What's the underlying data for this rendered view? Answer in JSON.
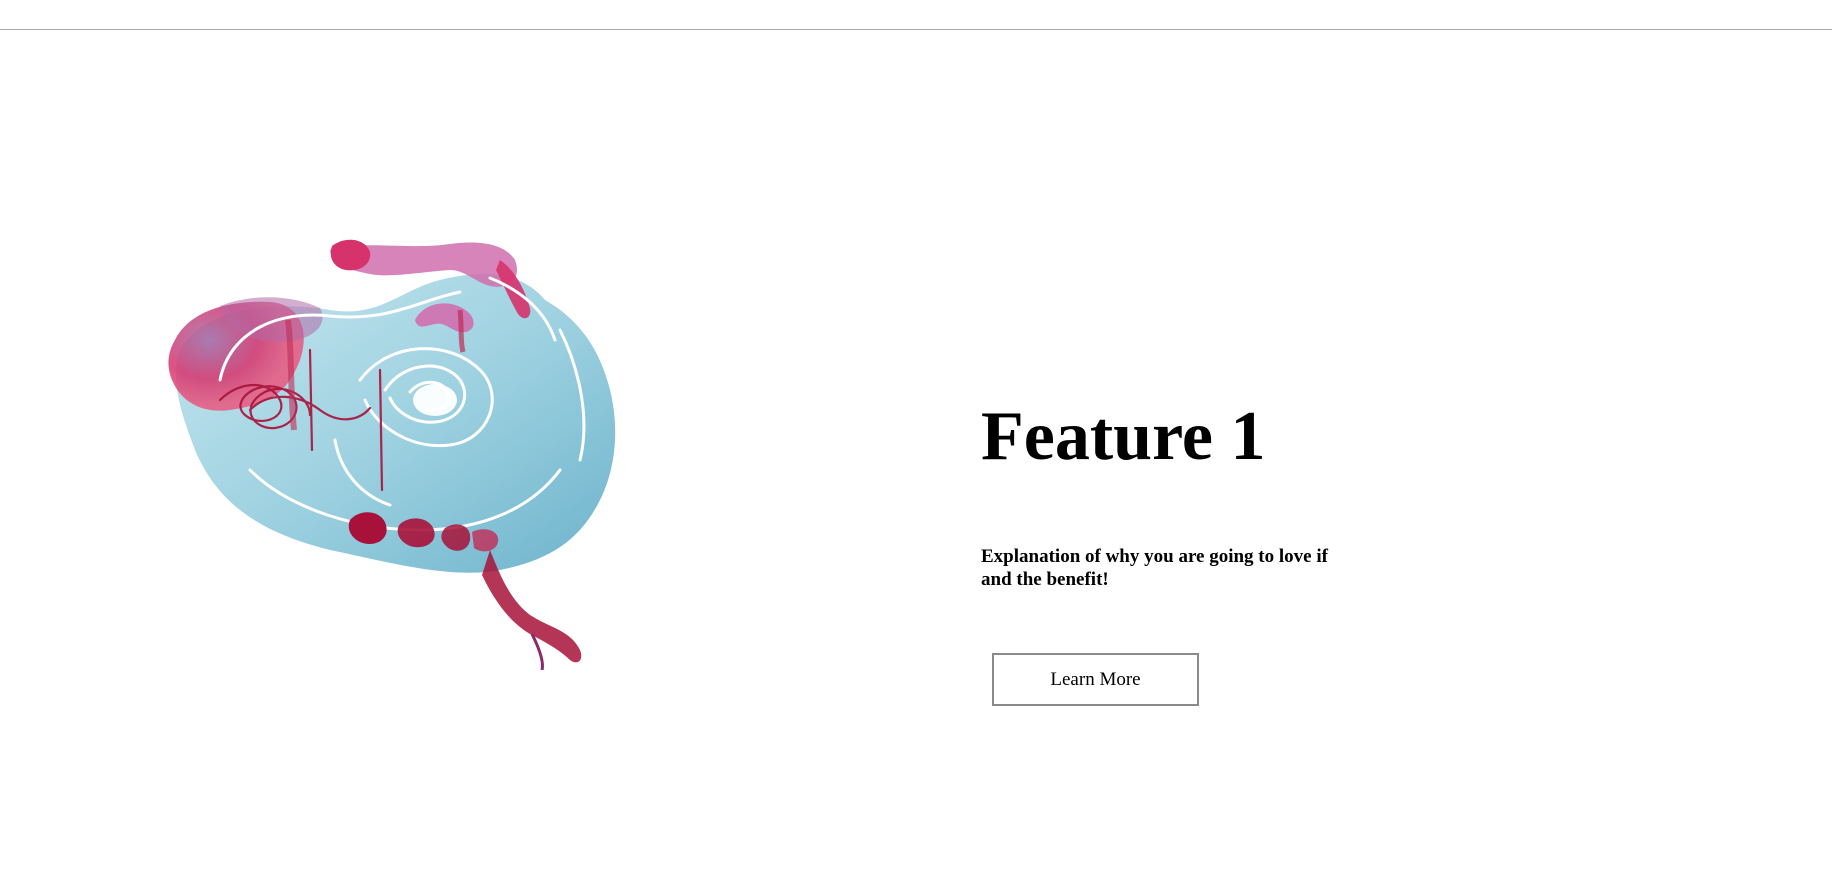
{
  "feature": {
    "title": "Feature 1",
    "description": "Explanation of why you are going to love if and the benefit!",
    "button_label": "Learn More"
  },
  "colors": {
    "divider": "#a9a9a9",
    "button_border": "#8a8a8a",
    "illustration_blue": "#8fcbdc",
    "illustration_pink": "#d6336c",
    "illustration_crimson": "#a8123a"
  }
}
